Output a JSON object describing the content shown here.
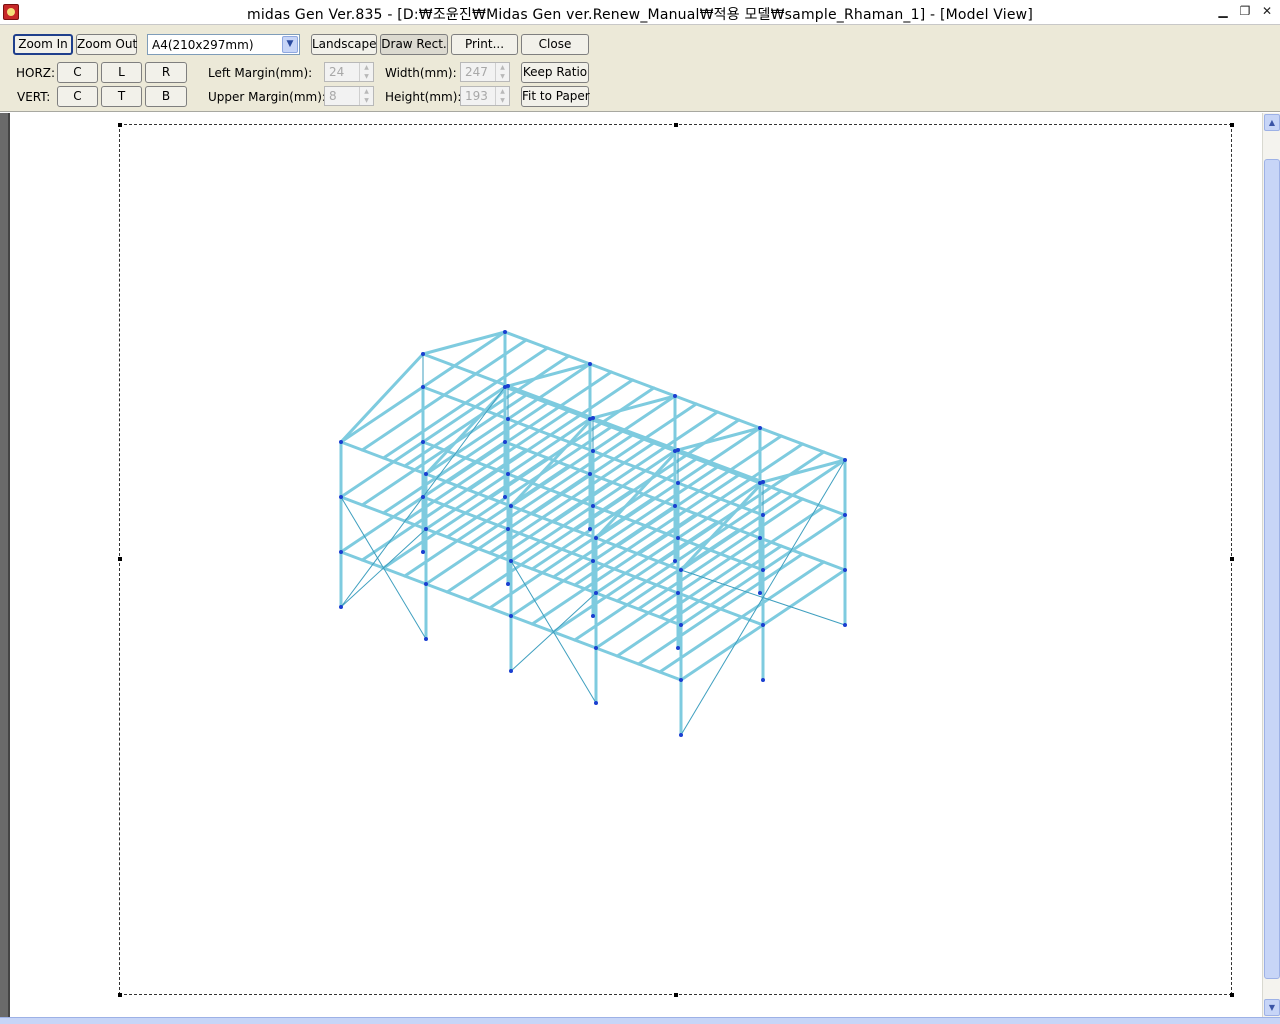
{
  "window": {
    "title": "midas Gen Ver.835 - [D:₩조윤진₩Midas Gen ver.Renew_Manual₩적용 모델₩sample_Rhaman_1] - [Model View]",
    "minimize_glyph": "▁",
    "restore_glyph": "❐",
    "close_glyph": "✕"
  },
  "toolbar": {
    "zoom_in": "Zoom In",
    "zoom_out": "Zoom Out",
    "paper_size": "A4(210x297mm)",
    "landscape": "Landscape",
    "draw_rect": "Draw Rect.",
    "print": "Print...",
    "close": "Close",
    "keep_ratio": "Keep Ratio",
    "fit_to_paper": "Fit to Paper",
    "horz_label": "HORZ:",
    "vert_label": "VERT:",
    "horz_buttons": [
      "C",
      "L",
      "R"
    ],
    "vert_buttons": [
      "C",
      "T",
      "B"
    ],
    "left_margin_label": "Left Margin(mm):",
    "left_margin_value": "24",
    "upper_margin_label": "Upper Margin(mm):",
    "upper_margin_value": "8",
    "width_label": "Width(mm):",
    "width_value": "247",
    "height_label": "Height(mm):",
    "height_value": "193"
  },
  "colors": {
    "frame_line": "#7ecbdf",
    "frame_dark": "#3f9fbf",
    "node": "#1a3fd0"
  },
  "icons": {
    "app": "midas-app-icon",
    "dropdown": "chevron-down-icon",
    "scroll_up": "scroll-up-arrow-icon",
    "scroll_down": "scroll-down-arrow-icon"
  }
}
